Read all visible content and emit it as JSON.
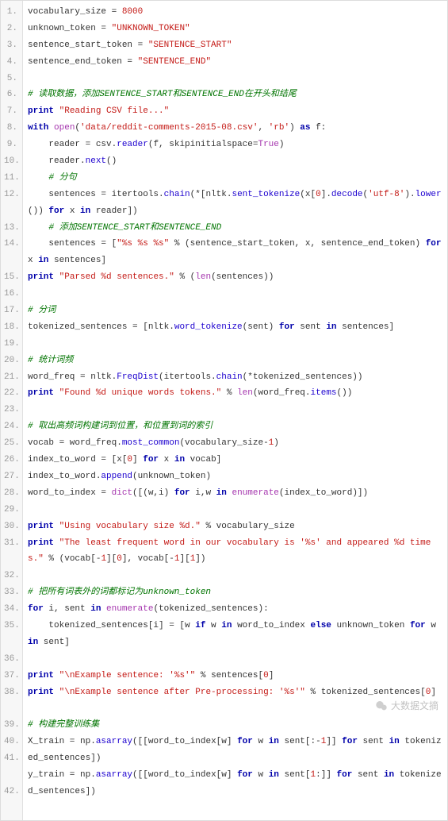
{
  "gutter": [
    "1.",
    "2.",
    "3.",
    "4.",
    "5.",
    "6.",
    "7.",
    "8.",
    "9.",
    "10.",
    "11.",
    "12.",
    "",
    "13.",
    "14.",
    "",
    "15.",
    "16.",
    "17.",
    "18.",
    "19.",
    "20.",
    "21.",
    "22.",
    "23.",
    "24.",
    "25.",
    "26.",
    "27.",
    "28.",
    "29.",
    "30.",
    "31.",
    "",
    "32.",
    "33.",
    "34.",
    "35.",
    "",
    "36.",
    "37.",
    "38.",
    "",
    "39.",
    "40.",
    "41.",
    "",
    "42.",
    ""
  ],
  "watermark_text": "大数据文摘",
  "tokens": {
    "l1": {
      "a": "vocabulary_size = ",
      "b": "8000"
    },
    "l2": {
      "a": "unknown_token = ",
      "b": "\"UNKNOWN_TOKEN\""
    },
    "l3": {
      "a": "sentence_start_token = ",
      "b": "\"SENTENCE_START\""
    },
    "l4": {
      "a": "sentence_end_token = ",
      "b": "\"SENTENCE_END\""
    },
    "l5": "",
    "l6": "# 读取数据，添加SENTENCE_START和SENTENCE_END在开头和结尾",
    "l7": {
      "a": "print",
      "b": " ",
      "c": "\"Reading CSV file...\""
    },
    "l8": {
      "a": "with",
      "b": " ",
      "c": "open",
      "d": "(",
      "e": "'data/reddit-comments-2015-08.csv'",
      "f": ", ",
      "g": "'rb'",
      "h": ") ",
      "i": "as",
      "j": " f:"
    },
    "l9": {
      "a": "    reader = csv.",
      "b": "reader",
      "c": "(f, skipinitialspace=",
      "d": "True",
      "e": ")"
    },
    "l10": {
      "a": "    reader.",
      "b": "next",
      "c": "()"
    },
    "l11": "    # 分句",
    "l12": {
      "a": "    sentences = itertools.",
      "b": "chain",
      "c": "(*[nltk.",
      "d": "sent_tokenize",
      "e": "(x[",
      "f": "0",
      "g": "].",
      "h": "decode",
      "i": "(",
      "j": "'utf-8'",
      "k": ").",
      "l": "lower",
      "m": "()) ",
      "n": "for",
      "o": " x ",
      "p": "in",
      "q": " reader])"
    },
    "l13": "    # 添加SENTENCE_START和SENTENCE_END",
    "l14": {
      "a": "    sentences = [",
      "b": "\"%s %s %s\"",
      "c": " % (sentence_start_token, x, sentence_end_token) ",
      "d": "for",
      "e": " x ",
      "f": "in",
      "g": " sentences]"
    },
    "l15": {
      "a": "print",
      "b": " ",
      "c": "\"Parsed %d sentences.\"",
      "d": " % (",
      "e": "len",
      "f": "(sentences))"
    },
    "l16": "",
    "l17": "# 分词",
    "l18": {
      "a": "tokenized_sentences = [nltk.",
      "b": "word_tokenize",
      "c": "(sent) ",
      "d": "for",
      "e": " sent ",
      "f": "in",
      "g": " sentences]"
    },
    "l19": "",
    "l20": "# 统计词频",
    "l21": {
      "a": "word_freq = nltk.",
      "b": "FreqDist",
      "c": "(itertools.",
      "d": "chain",
      "e": "(*tokenized_sentences))"
    },
    "l22": {
      "a": "print",
      "b": " ",
      "c": "\"Found %d unique words tokens.\"",
      "d": " % ",
      "e": "len",
      "f": "(word_freq.",
      "g": "items",
      "h": "())"
    },
    "l23": "",
    "l24": "# 取出高频词构建词到位置，和位置到词的索引",
    "l25": {
      "a": "vocab = word_freq.",
      "b": "most_common",
      "c": "(vocabulary_size-",
      "d": "1",
      "e": ")"
    },
    "l26": {
      "a": "index_to_word = [x[",
      "b": "0",
      "c": "] ",
      "d": "for",
      "e": " x ",
      "f": "in",
      "g": " vocab]"
    },
    "l27": {
      "a": "index_to_word.",
      "b": "append",
      "c": "(unknown_token)"
    },
    "l28": {
      "a": "word_to_index = ",
      "b": "dict",
      "c": "([(w,i) ",
      "d": "for",
      "e": " i,w ",
      "f": "in",
      "g": " ",
      "h": "enumerate",
      "i": "(index_to_word)])"
    },
    "l29": "",
    "l30": {
      "a": "print",
      "b": " ",
      "c": "\"Using vocabulary size %d.\"",
      "d": " % vocabulary_size"
    },
    "l31": {
      "a": "print",
      "b": " ",
      "c": "\"The least frequent word in our vocabulary is '%s' and appeared %d times.\"",
      "d": " % (vocab[-",
      "e": "1",
      "f": "][",
      "g": "0",
      "h": "], vocab[-",
      "i": "1",
      "j": "][",
      "k": "1",
      "l": "])"
    },
    "l32": "",
    "l33": "# 把所有词表外的词都标记为unknown_token",
    "l34": {
      "a": "for",
      "b": " i, sent ",
      "c": "in",
      "d": " ",
      "e": "enumerate",
      "f": "(tokenized_sentences):"
    },
    "l35": {
      "a": "    tokenized_sentences[i] = [w ",
      "b": "if",
      "c": " w ",
      "d": "in",
      "e": " word_to_index ",
      "f": "else",
      "g": " unknown_token ",
      "h": "for",
      "i": " w ",
      "j": "in",
      "k": " sent]"
    },
    "l36": "",
    "l37": {
      "a": "print",
      "b": " ",
      "c": "\"\\nExample sentence: '%s'\"",
      "d": " % sentences[",
      "e": "0",
      "f": "]"
    },
    "l38": {
      "a": "print",
      "b": " ",
      "c": "\"\\nExample sentence after Pre-processing: '%s'\"",
      "d": " % tokenized_sentences[",
      "e": "0",
      "f": "]"
    },
    "l39": "",
    "l40": "# 构建完整训练集",
    "l41": {
      "a": "X_train = np.",
      "b": "asarray",
      "c": "([[word_to_index[w] ",
      "d": "for",
      "e": " w ",
      "f": "in",
      "g": " sent[:-",
      "h": "1",
      "i": "]] ",
      "j": "for",
      "k": " sent ",
      "l": "in",
      "m": " tokenized_sentences])"
    },
    "l42": {
      "a": "y_train = np.",
      "b": "asarray",
      "c": "([[word_to_index[w] ",
      "d": "for",
      "e": " w ",
      "f": "in",
      "g": " sent[",
      "h": "1",
      "i": ":]] ",
      "j": "for",
      "k": " sent ",
      "l": "in",
      "m": " tokenized_sentences])"
    }
  }
}
